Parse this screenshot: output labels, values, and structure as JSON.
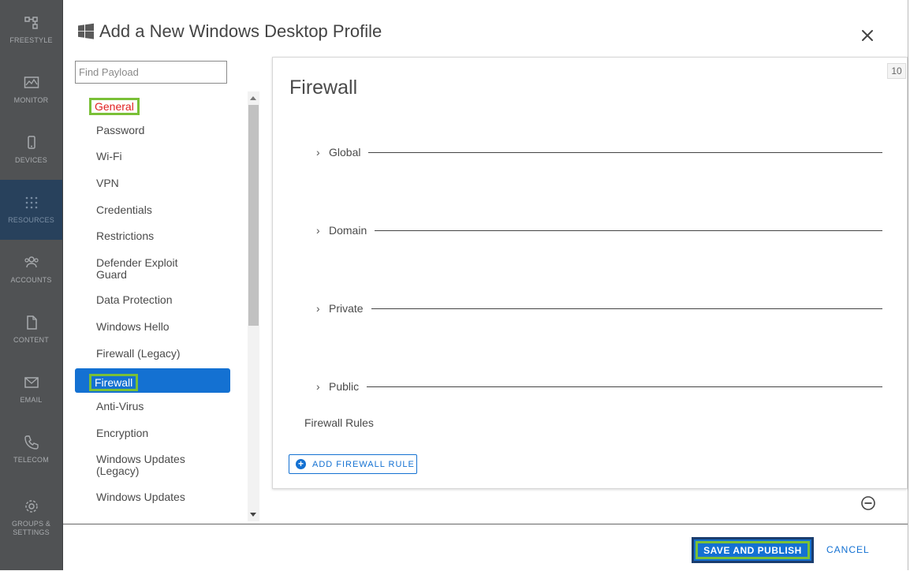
{
  "appnav": {
    "items": [
      {
        "label": "FREESTYLE",
        "icon": "freestyle-icon"
      },
      {
        "label": "MONITOR",
        "icon": "monitor-icon"
      },
      {
        "label": "DEVICES",
        "icon": "devices-icon"
      },
      {
        "label": "RESOURCES",
        "icon": "resources-icon"
      },
      {
        "label": "ACCOUNTS",
        "icon": "accounts-icon"
      },
      {
        "label": "CONTENT",
        "icon": "content-icon"
      },
      {
        "label": "EMAIL",
        "icon": "email-icon"
      },
      {
        "label": "TELECOM",
        "icon": "telecom-icon"
      },
      {
        "label": "GROUPS &\nSETTINGS",
        "icon": "settings-icon"
      }
    ],
    "active": "RESOURCES"
  },
  "modal": {
    "title": "Add a New Windows Desktop Profile",
    "title_icon": "windows-logo-icon"
  },
  "search": {
    "placeholder": "Find Payload",
    "value": ""
  },
  "payloads": [
    "General",
    "Password",
    "Wi-Fi",
    "VPN",
    "Credentials",
    "Restrictions",
    "Defender Exploit Guard",
    "Data Protection",
    "Windows Hello",
    "Firewall (Legacy)",
    "Firewall",
    "Anti-Virus",
    "Encryption",
    "Windows Updates (Legacy)",
    "Windows Updates"
  ],
  "selected_payload": "Firewall",
  "panel": {
    "title": "Firewall",
    "badge": "10",
    "sections": [
      "Global",
      "Domain",
      "Private",
      "Public"
    ],
    "rules_label": "Firewall Rules",
    "add_rule_label": "ADD FIREWALL RULE"
  },
  "footer": {
    "save_label": "SAVE AND PUBLISH",
    "cancel_label": "CANCEL"
  },
  "colors": {
    "accent": "#1471d2",
    "highlight": "#7ac037",
    "nav_bg": "#505254",
    "nav_active": "#28415c"
  }
}
